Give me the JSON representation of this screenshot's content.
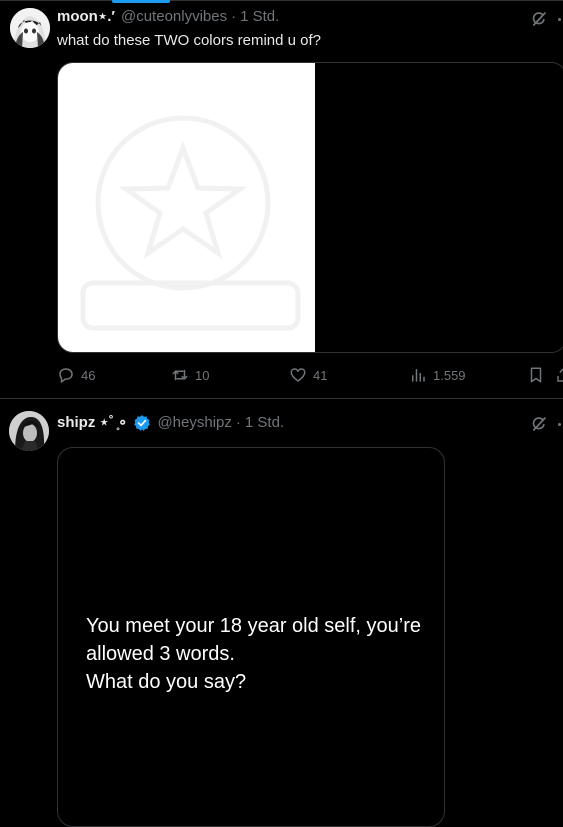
{
  "posts": [
    {
      "display_name": "moon⋆.′",
      "handle": "@cuteonlyvibes",
      "dot": "·",
      "time": "1 Std.",
      "text": "what do these TWO colors remind u of?",
      "media": {
        "left_color": "#ffffff",
        "right_color": "#000000"
      },
      "stats": {
        "replies": "46",
        "reposts": "10",
        "likes": "41",
        "views": "1.559"
      }
    },
    {
      "display_name": "shipz ⋆˚ ̥∘",
      "handle": "@heyshipz",
      "dot": "·",
      "time": "1 Std.",
      "verified": true,
      "card_lines": [
        "You meet your 18 year old self, you’re",
        "allowed 3 words.",
        "What do you say?"
      ]
    }
  ],
  "colors": {
    "background": "#000000",
    "text_primary": "#e7e9ea",
    "text_secondary": "#71767b",
    "accent": "#1d9bf0",
    "border": "#2f3336"
  },
  "icons": [
    "reply-icon",
    "repost-icon",
    "like-icon",
    "views-icon",
    "bookmark-icon",
    "share-icon",
    "grok-icon",
    "more-icon",
    "verified-icon"
  ]
}
